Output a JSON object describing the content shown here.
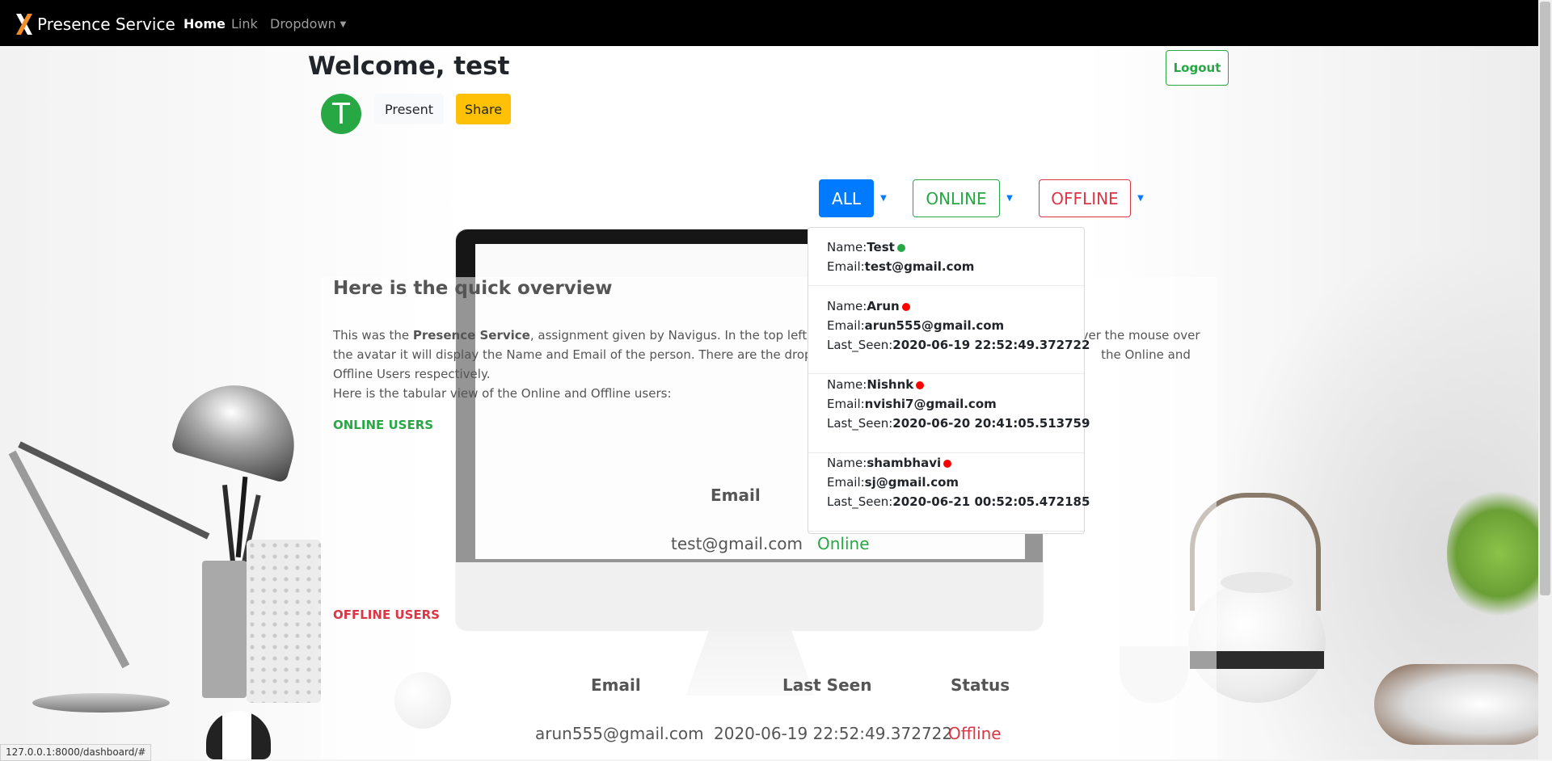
{
  "navbar": {
    "brand": "Presence Service",
    "items": [
      {
        "label": "Home"
      },
      {
        "label": "Link"
      },
      {
        "label": "Dropdown"
      }
    ]
  },
  "header": {
    "welcome": "Welcome, test",
    "logout_label": "Logout",
    "avatar_letter": "T",
    "present_label": "Present",
    "share_label": "Share"
  },
  "filters": {
    "all": "ALL",
    "online": "ONLINE",
    "offline": "OFFLINE"
  },
  "dropdown": {
    "users": [
      {
        "name_label": "Name:",
        "name": "Test",
        "email_label": "Email:",
        "email": "test@gmail.com",
        "status": "online",
        "status_color": "#28a745"
      },
      {
        "name_label": "Name:",
        "name": "Arun",
        "email_label": "Email:",
        "email": "arun555@gmail.com",
        "seen_label": "Last_Seen:",
        "last_seen": "2020-06-19 22:52:49.372722",
        "status": "offline",
        "status_color": "#ff0000"
      },
      {
        "name_label": "Name:",
        "name": "Nishnk",
        "email_label": "Email:",
        "email": "nvishi7@gmail.com",
        "seen_label": "Last_Seen:",
        "last_seen": "2020-06-20 20:41:05.513759",
        "status": "offline",
        "status_color": "#ff0000"
      },
      {
        "name_label": "Name:",
        "name": "shambhavi",
        "email_label": "Email:",
        "email": "sj@gmail.com",
        "seen_label": "Last_Seen:",
        "last_seen": "2020-06-21 00:52:05.472185",
        "status": "offline",
        "status_color": "#ff0000"
      }
    ]
  },
  "overview": {
    "title": "Here is the quick overview",
    "line1_pre": "This was the ",
    "line1_bold": "Presence Service",
    "line1_post": ", assignment given by Navigus. In the top left the",
    "line1_tail": "ver the mouse over",
    "line2": "the avatar it will display the Name and Email of the person. There are the dropd",
    "line2_tail": "the Online and",
    "line3": "Offline Users respectively.",
    "line4": "Here is the tabular view of the Online and Offline users:",
    "online_heading": "ONLINE USERS",
    "offline_heading": "OFFLINE USERS"
  },
  "online_table": {
    "headers": [
      "Email"
    ],
    "rows": [
      {
        "email": "test@gmail.com",
        "status": "Online"
      }
    ]
  },
  "offline_table": {
    "headers": [
      "Email",
      "Last Seen",
      "Status"
    ],
    "rows": [
      {
        "email": "arun555@gmail.com",
        "last_seen": "2020-06-19 22:52:49.372722",
        "status": "Offline"
      }
    ]
  },
  "status_bar": {
    "url": "127.0.0.1:8000/dashboard/#"
  },
  "colors": {
    "navbar": "#000000",
    "primary": "#007bff",
    "success": "#28a745",
    "danger": "#dc3545",
    "warning": "#ffc107"
  }
}
